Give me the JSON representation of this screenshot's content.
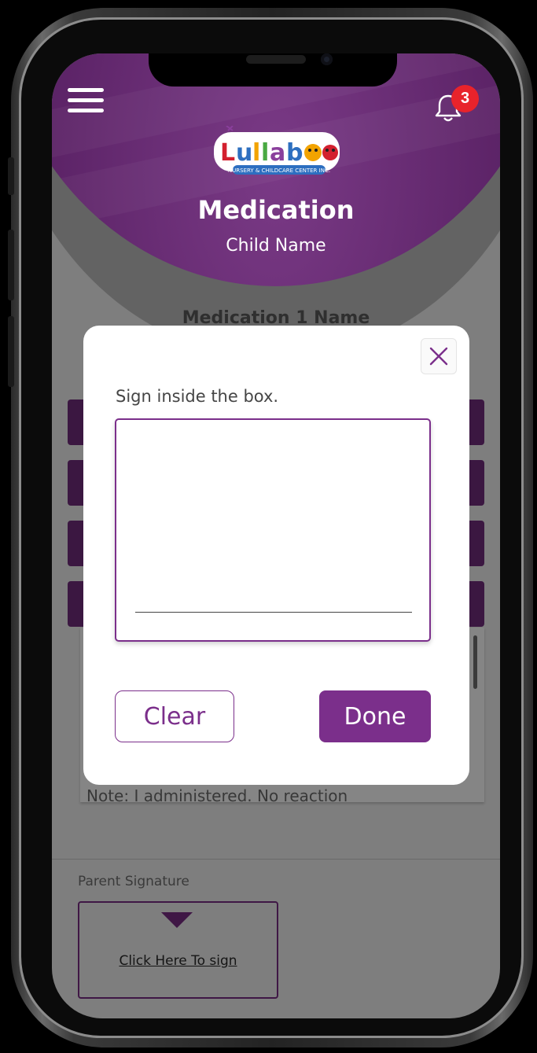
{
  "header": {
    "title": "Medication",
    "subtitle": "Child Name",
    "notification_count": "3",
    "logo": {
      "name": "Lullaboo",
      "tagline": "NURSERY & CHILDCARE CENTER INC."
    }
  },
  "content": {
    "medication_name": "Medication 1 Name",
    "note": "Note: I administered. No reaction",
    "parent_signature_label": "Parent Signature",
    "sign_link": "Click Here To sign"
  },
  "modal": {
    "instruction": "Sign inside the box.",
    "clear_label": "Clear",
    "done_label": "Done"
  },
  "colors": {
    "brand_purple": "#7b2f8b",
    "dark_purple": "#3f1745",
    "badge_red": "#e8232b"
  }
}
